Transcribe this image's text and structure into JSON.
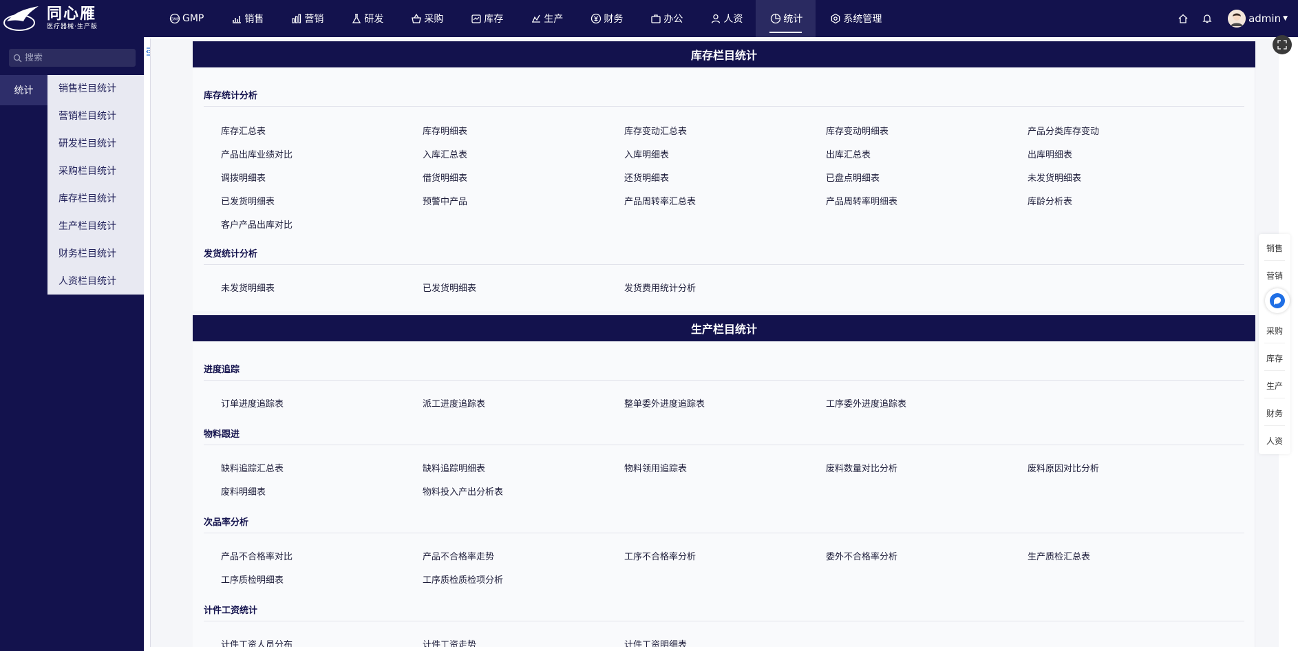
{
  "brand": {
    "name": "同心雁",
    "subtitle": "医疗器械·生产版"
  },
  "nav": {
    "items": [
      {
        "label": "GMP",
        "icon": "gmp-icon"
      },
      {
        "label": "销售",
        "icon": "bar-chart-icon"
      },
      {
        "label": "营销",
        "icon": "bar-chart-icon"
      },
      {
        "label": "研发",
        "icon": "flask-icon"
      },
      {
        "label": "采购",
        "icon": "basket-icon"
      },
      {
        "label": "库存",
        "icon": "inventory-icon"
      },
      {
        "label": "生产",
        "icon": "production-icon"
      },
      {
        "label": "财务",
        "icon": "yuan-icon"
      },
      {
        "label": "办公",
        "icon": "briefcase-icon"
      },
      {
        "label": "人资",
        "icon": "user-icon"
      },
      {
        "label": "统计",
        "icon": "pie-chart-icon",
        "active": true
      },
      {
        "label": "系统管理",
        "icon": "settings-icon"
      }
    ]
  },
  "user": {
    "name": "admin"
  },
  "search": {
    "placeholder": "搜索"
  },
  "sidebar": {
    "primary": "统计",
    "submenu": [
      "销售栏目统计",
      "营销栏目统计",
      "研发栏目统计",
      "采购栏目统计",
      "库存栏目统计",
      "生产栏目统计",
      "财务栏目统计",
      "人资栏目统计"
    ]
  },
  "sections": [
    {
      "title": "库存栏目统计",
      "groups": [
        {
          "title": "库存统计分析",
          "links": [
            "库存汇总表",
            "库存明细表",
            "库存变动汇总表",
            "库存变动明细表",
            "产品分类库存变动",
            "产品出库业绩对比",
            "入库汇总表",
            "入库明细表",
            "出库汇总表",
            "出库明细表",
            "调拨明细表",
            "借货明细表",
            "还货明细表",
            "已盘点明细表",
            "未发货明细表",
            "已发货明细表",
            "预警中产品",
            "产品周转率汇总表",
            "产品周转率明细表",
            "库龄分析表",
            "客户产品出库对比"
          ]
        },
        {
          "title": "发货统计分析",
          "links": [
            "未发货明细表",
            "已发货明细表",
            "发货费用统计分析"
          ]
        }
      ]
    },
    {
      "title": "生产栏目统计",
      "groups": [
        {
          "title": "进度追踪",
          "links": [
            "订单进度追踪表",
            "派工进度追踪表",
            "整单委外进度追踪表",
            "工序委外进度追踪表"
          ]
        },
        {
          "title": "物料跟进",
          "links": [
            "缺料追踪汇总表",
            "缺料追踪明细表",
            "物料领用追踪表",
            "废料数量对比分析",
            "废料原因对比分析",
            "废料明细表",
            "物料投入产出分析表"
          ]
        },
        {
          "title": "次品率分析",
          "links": [
            "产品不合格率对比",
            "产品不合格率走势",
            "工序不合格率分析",
            "委外不合格率分析",
            "生产质检汇总表",
            "工序质检明细表",
            "工序质检质检项分析"
          ]
        },
        {
          "title": "计件工资统计",
          "links": [
            "计件工资人员分布",
            "计件工资走势",
            "计件工资明细表"
          ]
        }
      ]
    }
  ],
  "quickbar": [
    "销售",
    "营销",
    "采购",
    "库存",
    "生产",
    "财务",
    "人资"
  ]
}
